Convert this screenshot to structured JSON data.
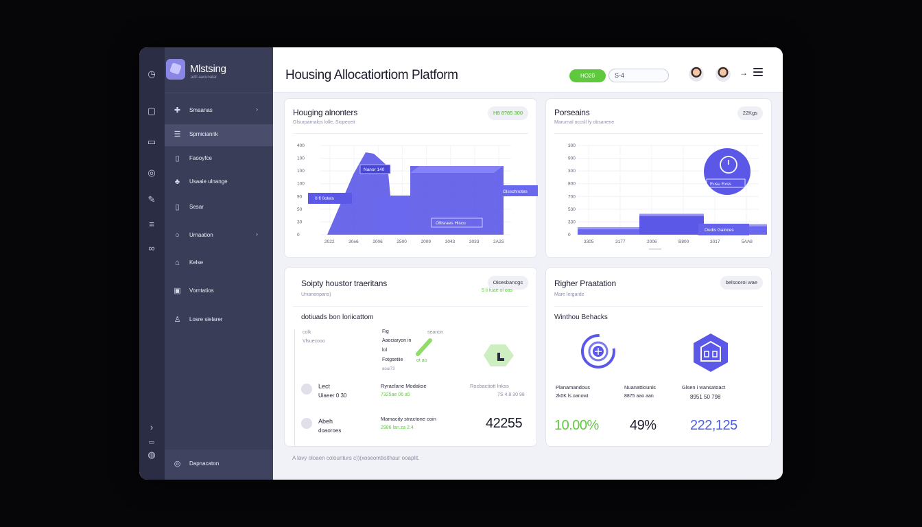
{
  "brand": {
    "name": "Mlstsing",
    "sub": "adtl aacunatar"
  },
  "rail_icons": [
    "clock-icon",
    "square-icon",
    "chat-icon",
    "target-icon",
    "tools-icon",
    "list-icon",
    "link-icon",
    "chevron-right-icon",
    "hash-icon",
    "globe-icon"
  ],
  "sidebar": {
    "items": [
      {
        "label": "Smaanas",
        "icon": "puzzle-icon",
        "chevron": "›"
      },
      {
        "label": "Sprnicianrik",
        "icon": "list-icon",
        "chevron": ""
      },
      {
        "label": "Faooyfce",
        "icon": "document-icon",
        "chevron": ""
      },
      {
        "label": "Usaaie ulnange",
        "icon": "people-icon",
        "chevron": ""
      },
      {
        "label": "Sesar",
        "icon": "file-icon",
        "chevron": ""
      },
      {
        "label": "Urnaation",
        "icon": "circle-icon",
        "chevron": "›"
      },
      {
        "label": "Kelse",
        "icon": "house-icon",
        "chevron": ""
      },
      {
        "label": "Vorntatios",
        "icon": "tag-icon",
        "chevron": ""
      },
      {
        "label": "Losre sielarer",
        "icon": "user-icon",
        "chevron": ""
      }
    ],
    "footer": {
      "label": "Dapnacaton",
      "icon": "gear-icon"
    }
  },
  "header": {
    "title": "Housing Allocatiortiom Platform",
    "status_pill": "HO20",
    "search_value": "S-4"
  },
  "cards": {
    "allocations": {
      "title": "Houging alnonters",
      "sub": "Glsurparnalos lolle, Siopeceit",
      "badge": "H8 8?85 300",
      "chart_labels": {
        "peak": "Nanor 140",
        "left": "0 fl 0otels",
        "right": "Glsschnotes",
        "mid": "Ofiisraes Hiscu"
      }
    },
    "personals": {
      "title": "Porseains",
      "sub": "Marurnal occsll fy obsanene",
      "badge": "22Kgs",
      "chart_labels": {
        "bubble": "Eusu Exss",
        "bar": "Oudis Galoces"
      }
    },
    "transactions": {
      "title": "Soipty houstor traeritans",
      "sub": "Unianonpans)",
      "badge": "Oisesbancgs",
      "badge_sub": "5 li fuae ol oas",
      "section": "dotiuads bon loriicattom",
      "left_col": [
        "colk",
        "Vlsuecooo"
      ],
      "mid_col": [
        "Fig",
        "Aaociaryon in",
        "lol",
        "Fotgsetiie",
        "aou/73"
      ],
      "mid_col_green": "ot ao",
      "mid_col_top": "seanon",
      "rows": [
        {
          "name": "Lect",
          "sub": "Uiaeer 0 30",
          "mid": "Ryraelane Modakse",
          "mid_sub": "7325ae 06 a5",
          "right": "Rocbactiott lnkss",
          "right_sub": "7S 4.8 30 98"
        },
        {
          "name": "Abeh",
          "sub": "doaoroes",
          "mid": "Mamacity stractone coin",
          "mid_sub": "2986 lan.za 2.4",
          "value": "42255"
        }
      ],
      "footer": "A lavy oloaen colounturs c))(xoseomtioithaur ooaplit."
    },
    "priorities": {
      "title": "Righer Praatation",
      "sub": "Mare lergarde",
      "badge": "belsooroi wae",
      "section": "Winthou Behacks",
      "stats": [
        {
          "label": "Planamandous",
          "sub": "2k0K ls oanowt",
          "value": "10.00%",
          "color": "#5fc93d"
        },
        {
          "label": "Nuanattiounis",
          "sub": "8875 aao aan",
          "value": "49%",
          "color": "#1a1b2b"
        },
        {
          "label": "Glsen i wansatoact",
          "sub": "8951 50 798",
          "value": "222,125",
          "color": "#4d5fe0"
        }
      ]
    }
  },
  "chart_data": [
    {
      "type": "area",
      "title": "Houging alnonters",
      "categories": [
        "2022",
        "30e6",
        "2006",
        "2500",
        "2009",
        "3043",
        "3033",
        "2A2S"
      ],
      "yticks": [
        "400",
        "100",
        "100",
        "100",
        "90",
        "50",
        "30",
        "0"
      ],
      "series": [
        {
          "values": [
            0,
            40,
            120,
            180,
            120,
            220,
            200,
            80
          ]
        }
      ],
      "ylim": [
        0,
        400
      ]
    },
    {
      "type": "bar",
      "title": "Porseains",
      "categories": [
        "3305",
        "3177",
        "2006",
        "B800",
        "3017",
        "5AA8"
      ],
      "yticks": [
        "300",
        "900",
        "300",
        "800",
        "700",
        "530",
        "330",
        "0"
      ],
      "values": [
        25,
        25,
        70,
        70,
        35,
        35
      ],
      "ylim": [
        0,
        300
      ]
    }
  ]
}
